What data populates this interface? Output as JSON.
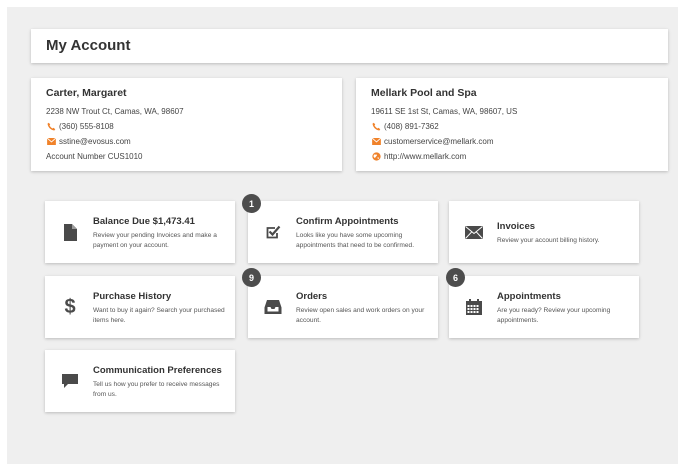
{
  "page": {
    "title": "My Account"
  },
  "customer": {
    "name": "Carter, Margaret",
    "address": "2238 NW Trout Ct, Camas, WA, 98607",
    "phone": "(360) 555-8108",
    "email": "sstine@evosus.com",
    "account": "Account Number CUS1010"
  },
  "company": {
    "name": "Mellark Pool and Spa",
    "address": "19611 SE 1st St, Camas, WA, 98607, US",
    "phone": "(408) 891-7362",
    "email": "customerservice@mellark.com",
    "website": "http://www.mellark.com"
  },
  "colors": {
    "accent": "#f0822a",
    "icon": "#4a4a4a",
    "badge": "#4d4d4d"
  },
  "tiles": [
    {
      "title": "Balance Due $1,473.41",
      "desc": "Review your pending Invoices and make a payment on your account.",
      "icon": "document-icon"
    },
    {
      "title": "Confirm Appointments",
      "desc": "Looks like you have some upcoming appointments that need to be confirmed.",
      "icon": "checkbox-icon",
      "badge": "1"
    },
    {
      "title": "Invoices",
      "desc": "Review your account billing history.",
      "icon": "envelope-icon"
    },
    {
      "title": "Purchase History",
      "desc": "Want to buy it again? Search your purchased items here.",
      "icon": "dollar-icon"
    },
    {
      "title": "Orders",
      "desc": "Review open sales and work orders on your account.",
      "icon": "inbox-icon",
      "badge": "9"
    },
    {
      "title": "Appointments",
      "desc": "Are you ready? Review your upcoming appointments.",
      "icon": "calendar-icon",
      "badge": "6"
    },
    {
      "title": "Communication Preferences",
      "desc": "Tell us how you prefer to receive messages from us.",
      "icon": "chat-bubble-icon"
    }
  ]
}
